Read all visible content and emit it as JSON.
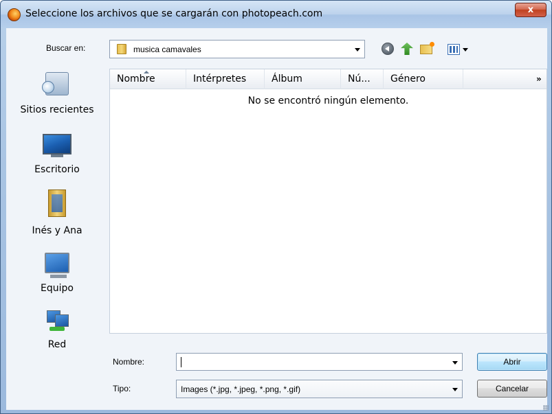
{
  "window": {
    "title": "Seleccione los archivos que se cargarán con photopeach.com",
    "close_label": "x"
  },
  "lookin": {
    "label": "Buscar en:",
    "value": "musica camavales"
  },
  "toolbar": {
    "icons": [
      "back-icon",
      "up-folder-icon",
      "new-folder-icon",
      "views-menu-icon"
    ]
  },
  "sidebar": {
    "items": [
      {
        "label": "Sitios recientes",
        "icon": "recent-places-icon"
      },
      {
        "label": "Escritorio",
        "icon": "desktop-icon"
      },
      {
        "label": "Inés y Ana",
        "icon": "user-folder-icon"
      },
      {
        "label": "Equipo",
        "icon": "computer-icon"
      },
      {
        "label": "Red",
        "icon": "network-icon"
      }
    ]
  },
  "filelist": {
    "columns": [
      "Nombre",
      "Intérpretes",
      "Álbum",
      "Nú...",
      "Género"
    ],
    "more_columns": "»",
    "empty_message": "No se encontró ningún elemento."
  },
  "form": {
    "name_label": "Nombre:",
    "name_value": "",
    "type_label": "Tipo:",
    "type_value": "Images (*.jpg, *.jpeg, *.png, *.gif)"
  },
  "buttons": {
    "open": "Abrir",
    "cancel": "Cancelar"
  },
  "colors": {
    "title_bar": "#bcd2ec",
    "close_button": "#c0411f",
    "open_button": "#bde6fd"
  }
}
